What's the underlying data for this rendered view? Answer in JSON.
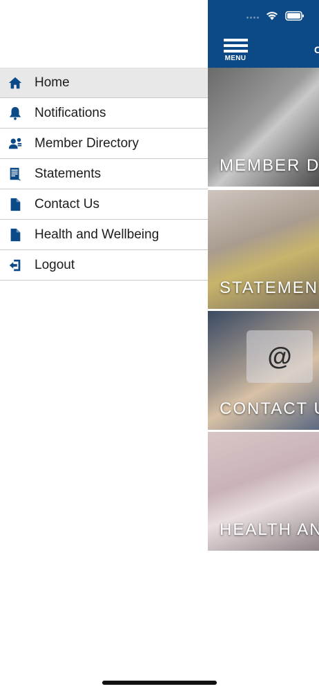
{
  "drawer": {
    "items": [
      {
        "label": "Home",
        "icon": "home-icon",
        "active": true
      },
      {
        "label": "Notifications",
        "icon": "bell-icon"
      },
      {
        "label": "Member Directory",
        "icon": "member-directory-icon"
      },
      {
        "label": "Statements",
        "icon": "statements-icon"
      },
      {
        "label": "Contact Us",
        "icon": "document-icon"
      },
      {
        "label": "Health and Wellbeing",
        "icon": "document-icon"
      },
      {
        "label": "Logout",
        "icon": "logout-icon"
      }
    ]
  },
  "app": {
    "menu_label": "MENU",
    "header_title_fragment": "C",
    "tiles": [
      {
        "label": "MEMBER D"
      },
      {
        "label": "STATEMEN"
      },
      {
        "label": "CONTACT U",
        "badge": "@"
      },
      {
        "label": "HEALTH AN"
      }
    ]
  },
  "colors": {
    "brand": "#0b4a86",
    "active_row": "#e8e8e8",
    "divider": "#c8c8c8"
  }
}
